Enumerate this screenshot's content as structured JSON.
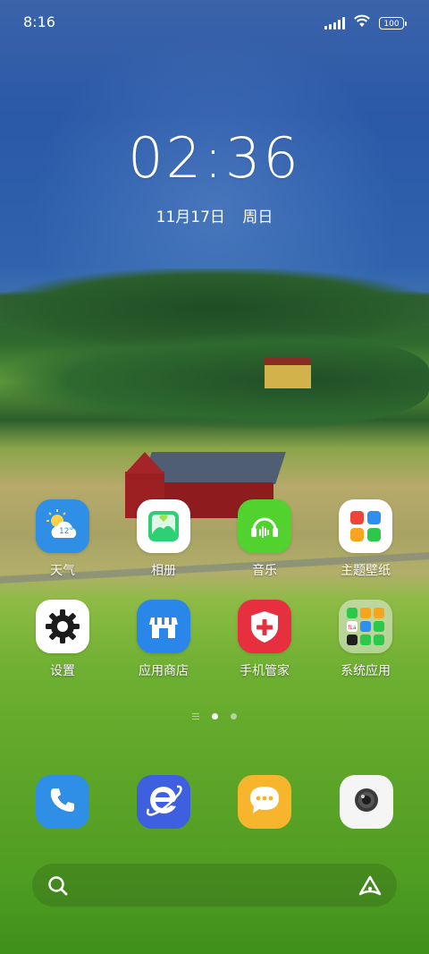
{
  "status_bar": {
    "time": "8:16",
    "battery": "100"
  },
  "lock_clock": {
    "time": "02:36",
    "date": "11月17日",
    "weekday": "周日"
  },
  "weather": {
    "temperature": "12°"
  },
  "apps": [
    {
      "label": "天气",
      "icon": "weather-icon",
      "color": "#2f8ee6"
    },
    {
      "label": "相册",
      "icon": "gallery-icon",
      "color": "#ffffff"
    },
    {
      "label": "音乐",
      "icon": "music-icon",
      "color": "#52d22e"
    },
    {
      "label": "主题壁纸",
      "icon": "themes-icon",
      "color": "#ffffff"
    },
    {
      "label": "设置",
      "icon": "gear-icon",
      "color": "#ffffff"
    },
    {
      "label": "应用商店",
      "icon": "app-store-icon",
      "color": "#2a86e8"
    },
    {
      "label": "手机管家",
      "icon": "phone-manager-icon",
      "color": "#e6303f"
    },
    {
      "label": "系统应用",
      "icon": "folder-icon",
      "color": "#e8efe2"
    }
  ],
  "folder": {
    "mini_labels": [
      "fLa"
    ]
  },
  "dock": [
    {
      "name": "phone",
      "icon": "phone-icon",
      "color": "#2f8ee6"
    },
    {
      "name": "browser",
      "icon": "browser-icon",
      "color": "#3d5fe0"
    },
    {
      "name": "messages",
      "icon": "messages-icon",
      "color": "#f6b52c"
    },
    {
      "name": "camera",
      "icon": "camera-icon",
      "color": "#f5f5f5"
    }
  ],
  "pages": {
    "count": 2,
    "active": 1
  }
}
